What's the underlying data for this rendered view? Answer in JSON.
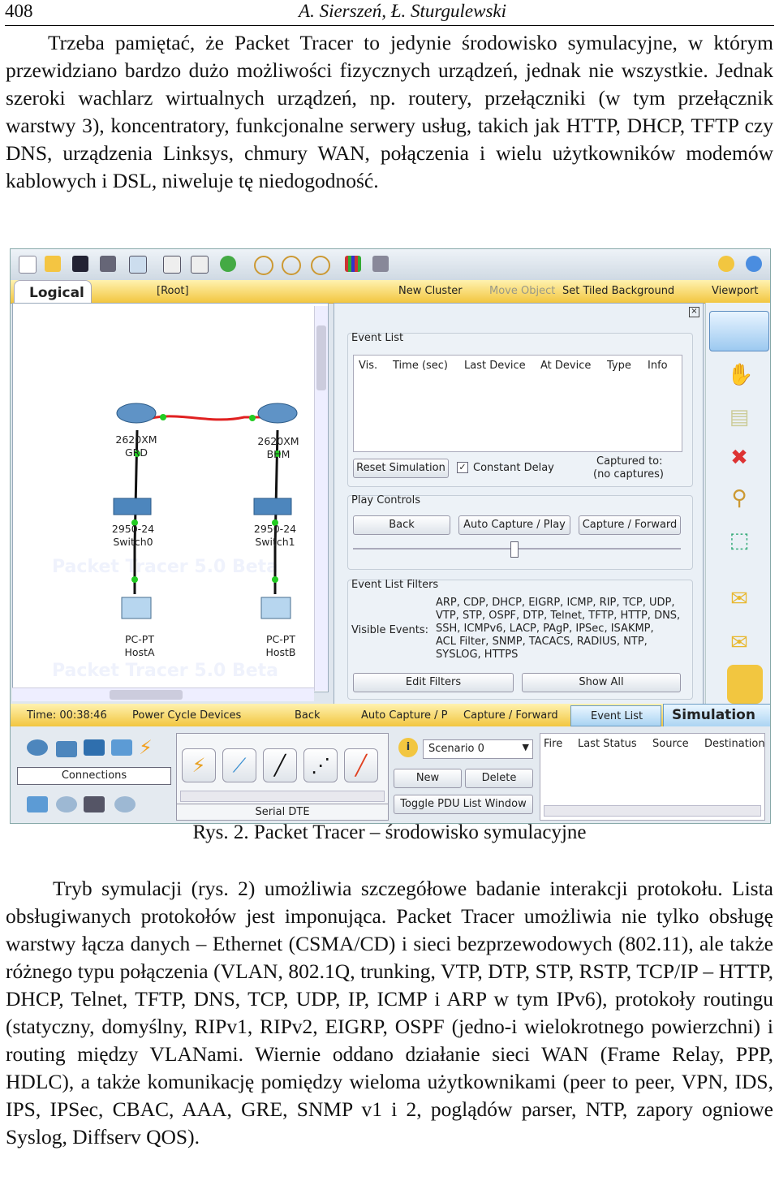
{
  "header": {
    "page_number": "408",
    "authors": "A. Sierszeń, Ł. Sturgulewski"
  },
  "paragraph1": "Trzeba pamiętać, że Packet Tracer to jedynie środowisko symulacyjne, w którym przewidziano bardzo dużo możliwości fizycznych urządzeń, jednak nie wszystkie. Jednak szeroki wachlarz wirtualnych urządzeń, np. routery, przełączniki (w tym przełącznik warstwy 3), koncentratory, funkcjonalne serwery usług, takich jak HTTP, DHCP, TFTP czy DNS, urządzenia Linksys, chmury WAN, połączenia i wielu użytkowników modemów kablowych i DSL, niweluje tę niedogodność.",
  "figure": {
    "caption": "Rys. 2. Packet Tracer – środowisko symulacyjne",
    "logical_bar": {
      "tab": "Logical",
      "root": "[Root]",
      "new_cluster": "New Cluster",
      "move_object": "Move Object",
      "set_bg": "Set Tiled Background",
      "viewport": "Viewport"
    },
    "devices": [
      {
        "line1": "2620XM",
        "line2": "GRD"
      },
      {
        "line1": "2620XM",
        "line2": "BHM"
      },
      {
        "line1": "2950-24",
        "line2": "Switch0"
      },
      {
        "line1": "2950-24",
        "line2": "Switch1"
      },
      {
        "line1": "PC-PT",
        "line2": "HostA"
      },
      {
        "line1": "PC-PT",
        "line2": "HostB"
      }
    ],
    "watermark": "Packet Tracer 5.0 Beta",
    "event_list": {
      "label": "Event List",
      "columns": [
        "Vis.",
        "Time (sec)",
        "Last Device",
        "At Device",
        "Type",
        "Info"
      ],
      "reset": "Reset Simulation",
      "constant_delay": "Constant Delay",
      "captured_to": "Captured to:",
      "no_captures": "(no captures)"
    },
    "play_controls": {
      "label": "Play Controls",
      "back": "Back",
      "auto": "Auto Capture / Play",
      "capture": "Capture / Forward"
    },
    "filters": {
      "label": "Event List Filters",
      "visible_label": "Visible Events:",
      "lines": [
        "ARP, CDP, DHCP, EIGRP, ICMP, RIP, TCP, UDP,",
        "VTP, STP, OSPF, DTP, Telnet, TFTP, HTTP, DNS,",
        "SSH, ICMPv6, LACP, PAgP, IPSec, ISAKMP,",
        "ACL Filter, SNMP, TACACS, RADIUS, NTP,",
        "SYSLOG, HTTPS"
      ],
      "edit": "Edit Filters",
      "show_all": "Show All"
    },
    "status_bar": {
      "time": "Time: 00:38:46",
      "power": "Power Cycle Devices",
      "back": "Back",
      "auto": "Auto Capture / P",
      "capture": "Capture / Forward",
      "event_list": "Event List",
      "mode": "Simulation"
    },
    "bottom": {
      "connections": "Connections",
      "serial": "Serial DTE",
      "scenario": "Scenario 0",
      "new": "New",
      "delete": "Delete",
      "toggle": "Toggle PDU List Window",
      "pdu_cols": [
        "Fire",
        "Last Status",
        "Source",
        "Destination"
      ]
    },
    "colors": {
      "serial_link": "#e02020",
      "ethernet_link": "#101010",
      "link_up": "#22cc22",
      "toolbar_yellow": "#f2c640"
    }
  },
  "paragraph2": "Tryb symulacji (rys. 2) umożliwia szczegółowe badanie interakcji protokołu. Lista obsługiwanych protokołów jest imponująca. Packet Tracer umożliwia nie tylko obsługę warstwy łącza danych – Ethernet (CSMA/CD) i sieci bezprzewodowych (802.11), ale także różnego typu połączenia (VLAN, 802.1Q, trunking, VTP, DTP, STP, RSTP, TCP/IP – HTTP, DHCP, Telnet, TFTP, DNS, TCP, UDP, IP, ICMP i ARP w tym IPv6), protokoły routingu (statyczny, domyślny, RIPv1, RIPv2, EIGRP, OSPF (jedno-i wielokrotnego powierzchni) i routing między VLANami. Wiernie oddano działanie sieci WAN (Frame Relay, PPP, HDLC), a także komunikację pomiędzy wieloma użytkownikami (peer to peer, VPN, IDS, IPS, IPSec, CBAC, AAA, GRE, SNMP v1 i 2, poglądów parser, NTP, zapory ogniowe Syslog, Diffserv QOS)."
}
